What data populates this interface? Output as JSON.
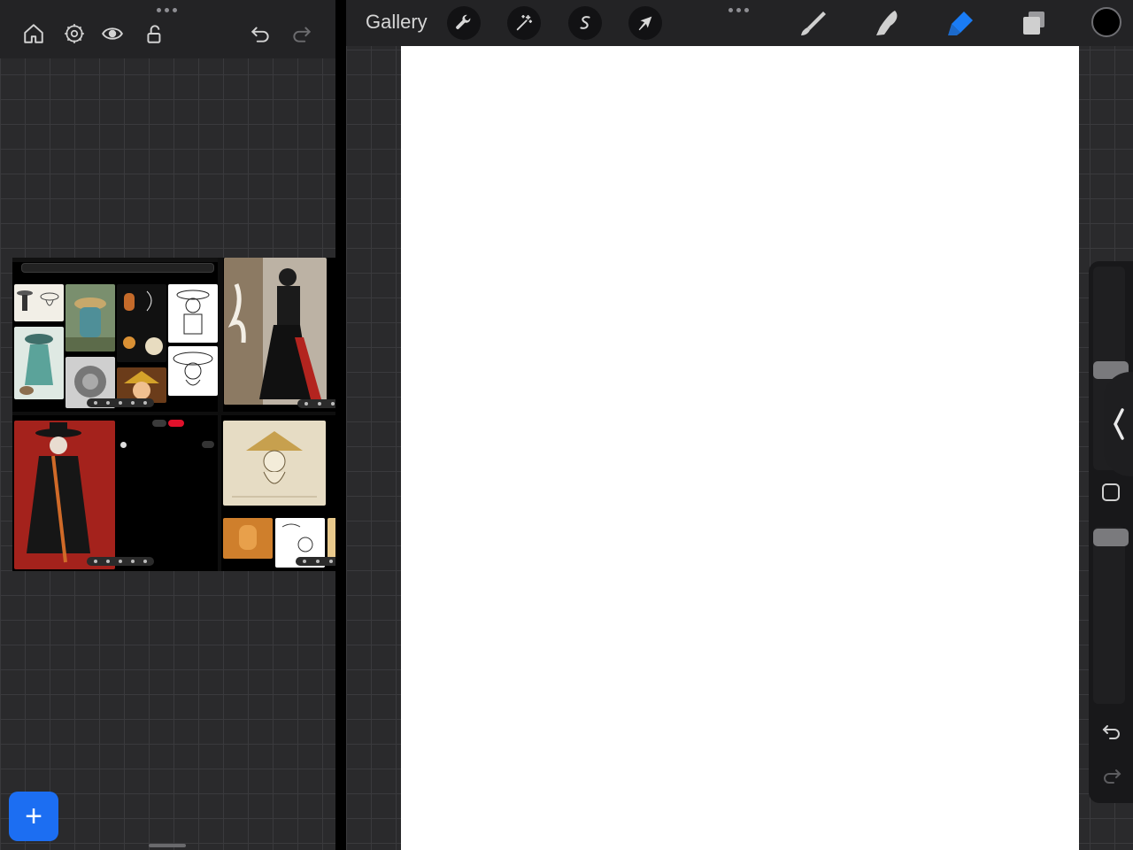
{
  "left_pane": {
    "toolbar": {
      "icons": [
        "home-icon",
        "settings-icon",
        "eye-icon",
        "lock-icon",
        "undo-icon",
        "redo-icon"
      ]
    },
    "add_button": {
      "icon": "plus-icon",
      "color": "#1c6ef2"
    }
  },
  "procreate": {
    "gallery_label": "Gallery",
    "tools": [
      "wrench-icon",
      "magic-wand-icon",
      "selection-icon",
      "transform-arrow-icon"
    ],
    "paint_tools": [
      "brush-icon",
      "smudge-icon",
      "eraser-icon",
      "layers-icon"
    ],
    "active_tool_color": "#1a7cf5",
    "current_color": "#000000",
    "canvas_color": "#ffffff"
  }
}
